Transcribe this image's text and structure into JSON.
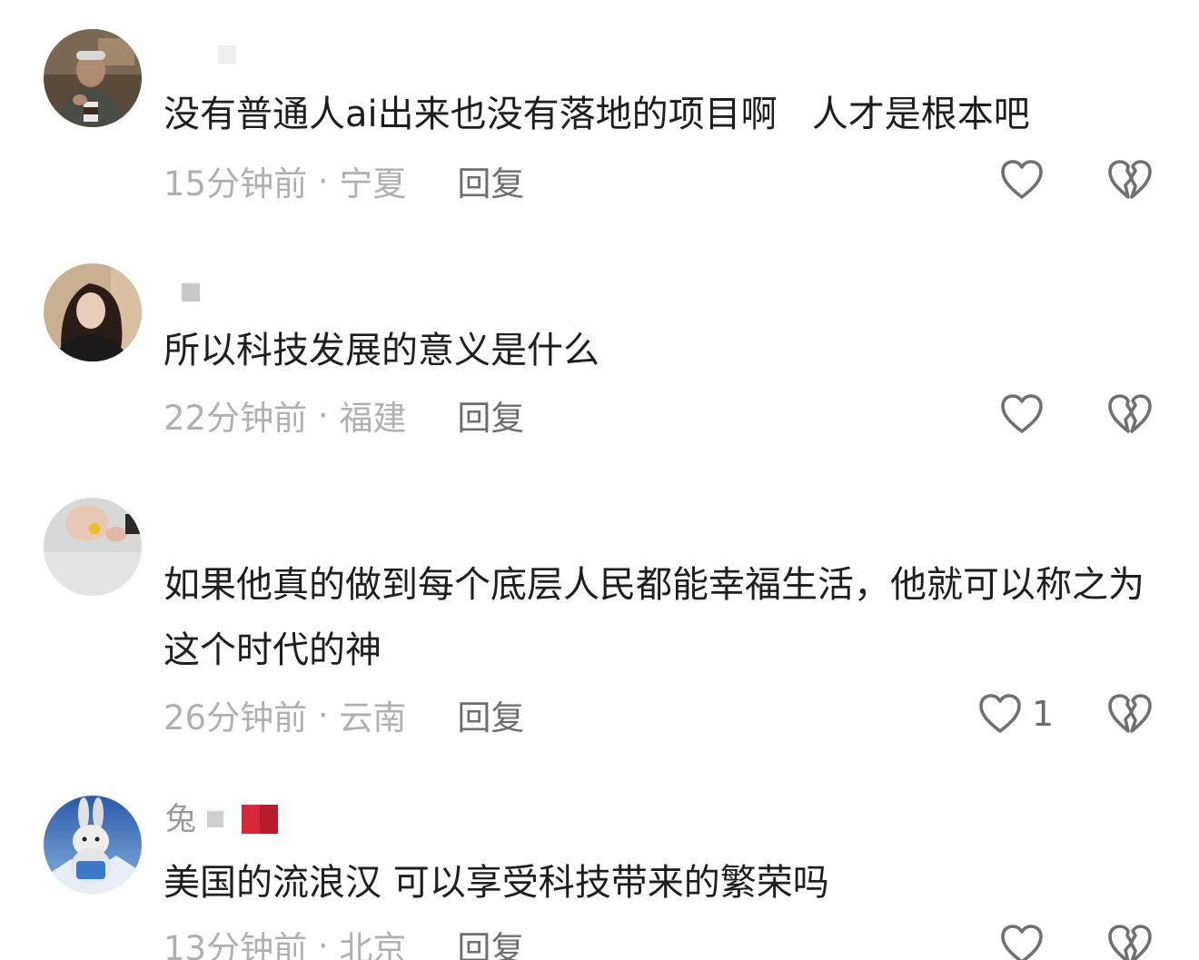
{
  "icons": {
    "like": "heart-outline-icon",
    "dislike": "broken-heart-icon"
  },
  "colors": {
    "text": "#1e1e1e",
    "meta": "#b0b0b0",
    "reply": "#6e6e6e",
    "icon": "#707070",
    "badge": "#d8283a"
  },
  "comments": [
    {
      "username": "",
      "text": "没有普通人ai出来也没有落地的项目啊   人才是根本吧",
      "time": "15分钟前",
      "location": "宁夏",
      "reply_label": "回复",
      "like_count": ""
    },
    {
      "username": "",
      "text": "所以科技发展的意义是什么",
      "time": "22分钟前",
      "location": "福建",
      "reply_label": "回复",
      "like_count": ""
    },
    {
      "username": "",
      "text": "如果他真的做到每个底层人民都能幸福生活，他就可以称之为这个时代的神",
      "time": "26分钟前",
      "location": "云南",
      "reply_label": "回复",
      "like_count": "1"
    },
    {
      "username": "兔",
      "text": "美国的流浪汉 可以享受科技带来的繁荣吗",
      "time": "13分钟前",
      "location": "北京",
      "reply_label": "回复",
      "like_count": ""
    }
  ]
}
